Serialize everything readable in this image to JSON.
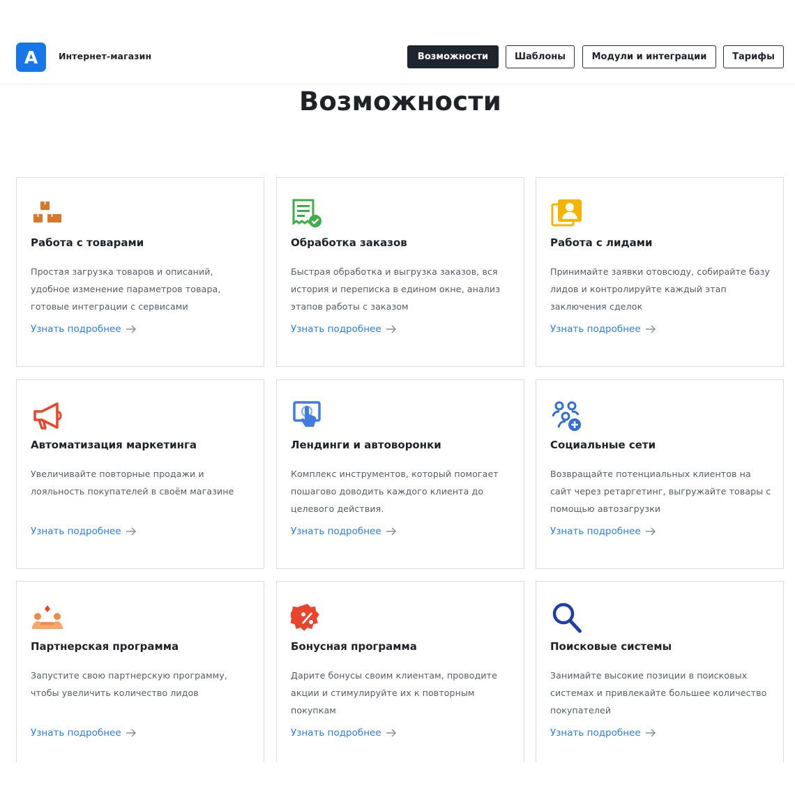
{
  "header": {
    "logo_letter": "A",
    "brand": "Интернет-магазин",
    "nav": [
      {
        "label": "Возможности",
        "active": true
      },
      {
        "label": "Шаблоны",
        "active": false
      },
      {
        "label": "Модули и интеграции",
        "active": false
      },
      {
        "label": "Тарифы",
        "active": false
      }
    ]
  },
  "page_title": "Возможности",
  "colors": {
    "accent": "#1877e8",
    "link": "#2b7de0",
    "nav_active_bg": "#1f252d"
  },
  "cards": [
    {
      "icon": "boxes-icon",
      "title": "Работа с товарами",
      "desc": "Простая загрузка товаров и описаний, удобное изменение параметров товара, готовые интеграции с сервисами",
      "link": "Узнать подробнее"
    },
    {
      "icon": "order-receipt-icon",
      "title": "Обработка заказов",
      "desc": "Быстрая обработка и выгрузка заказов, вся история и переписка в едином окне, анализ этапов работы с заказом",
      "link": "Узнать подробнее"
    },
    {
      "icon": "contacts-book-icon",
      "title": "Работа с лидами",
      "desc": "Принимайте заявки отовсюду, собирайте базу лидов и контролируйте каждый этап заключения сделок",
      "link": "Узнать подробнее"
    },
    {
      "icon": "megaphone-icon",
      "title": "Автоматизация маркетинга",
      "desc": "Увеличивайте повторные продажи и лояльность покупателей в своём магазине",
      "link": "Узнать подробнее"
    },
    {
      "icon": "touch-screen-icon",
      "title": "Лендинги и автоворонки",
      "desc": "Комплекс инструментов, который помогает пошагово доводить каждого клиента до целевого действия.",
      "link": "Узнать подробнее"
    },
    {
      "icon": "social-users-icon",
      "title": "Социальные сети",
      "desc": "Возвращайте потенциальных клиентов на сайт через ретаргетинг, выгружайте товары с помощью автозагрузки",
      "link": "Узнать подробнее"
    },
    {
      "icon": "partners-icon",
      "title": "Партнерская программа",
      "desc": "Запустите свою партнерскую программу, чтобы увеличить количество лидов",
      "link": "Узнать подробнее"
    },
    {
      "icon": "discount-badge-icon",
      "title": "Бонусная программа",
      "desc": "Дарите бонусы своим клиентам, проводите акции и стимулируйте их к повторным покупкам",
      "link": "Узнать подробнее"
    },
    {
      "icon": "search-icon",
      "title": "Поисковые системы",
      "desc": "Занимайте высокие позиции в поисковых системах и привлекайте большее количество покупателей",
      "link": "Узнать подробнее"
    }
  ]
}
